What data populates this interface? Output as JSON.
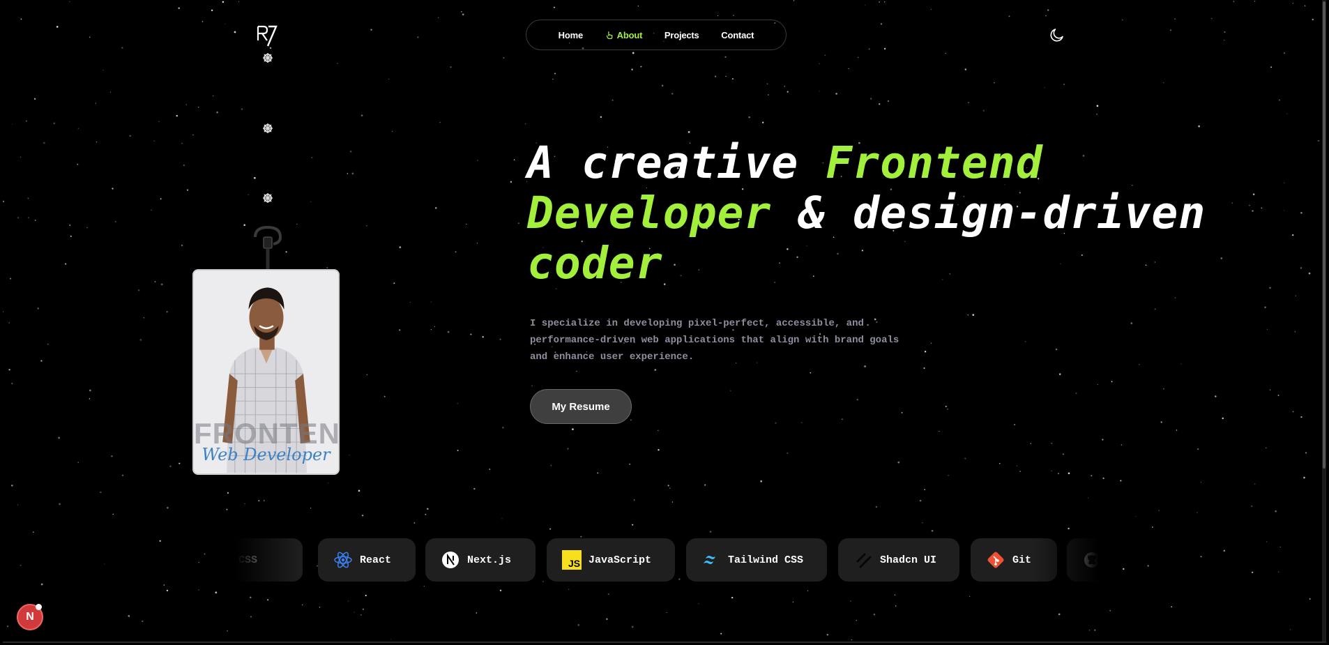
{
  "brand": {
    "logo_text": "R7"
  },
  "nav": {
    "items": [
      {
        "label": "Home",
        "active": false
      },
      {
        "label": "About",
        "active": true
      },
      {
        "label": "Projects",
        "active": false
      },
      {
        "label": "Contact",
        "active": false
      }
    ]
  },
  "theme_toggle": {
    "icon": "moon-icon"
  },
  "badge": {
    "title": "FRONTEND",
    "subtitle": "Web Developer"
  },
  "hero": {
    "line1_plain": "A creative ",
    "line1_accent": "Frontend",
    "line2_accent": "Developer",
    "line2_plain": " & design-driven",
    "line3_accent": "coder",
    "description_line1": "I specialize in developing pixel-perfect, accessible, and",
    "description_line2": "performance-driven web applications that align with brand goals",
    "description_line3": "and enhance user experience.",
    "resume_label": "My Resume"
  },
  "skills": [
    {
      "label": "CSS",
      "icon": "css-icon"
    },
    {
      "label": "React",
      "icon": "react-icon"
    },
    {
      "label": "Next.js",
      "icon": "nextjs-icon"
    },
    {
      "label": "JavaScript",
      "icon": "javascript-icon"
    },
    {
      "label": "Tailwind CSS",
      "icon": "tailwind-icon"
    },
    {
      "label": "Shadcn UI",
      "icon": "shadcn-icon"
    },
    {
      "label": "Git",
      "icon": "git-icon"
    },
    {
      "label": "",
      "icon": "github-icon"
    }
  ],
  "dev_indicator": {
    "label": "N"
  },
  "colors": {
    "accent": "#a3f03c",
    "background": "#000000",
    "chip": "#1f1f1f"
  }
}
